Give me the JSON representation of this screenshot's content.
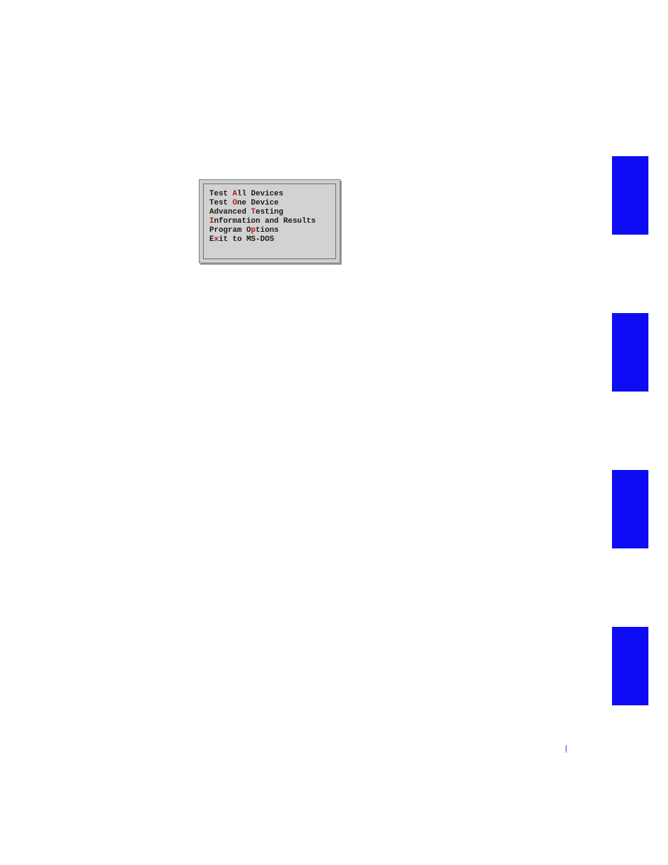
{
  "menu": {
    "items": [
      {
        "pre": "Test ",
        "hot": "A",
        "post": "ll Devices"
      },
      {
        "pre": "Test ",
        "hot": "O",
        "post": "ne Device"
      },
      {
        "pre": "Advanced ",
        "hot": "T",
        "post": "esting"
      },
      {
        "pre": "",
        "hot": "I",
        "post": "nformation and Results"
      },
      {
        "pre": "Program O",
        "hot": "p",
        "post": "tions"
      },
      {
        "pre": "E",
        "hot": "x",
        "post": "it to MS-DOS"
      }
    ]
  },
  "footer": {
    "separator": "|"
  }
}
